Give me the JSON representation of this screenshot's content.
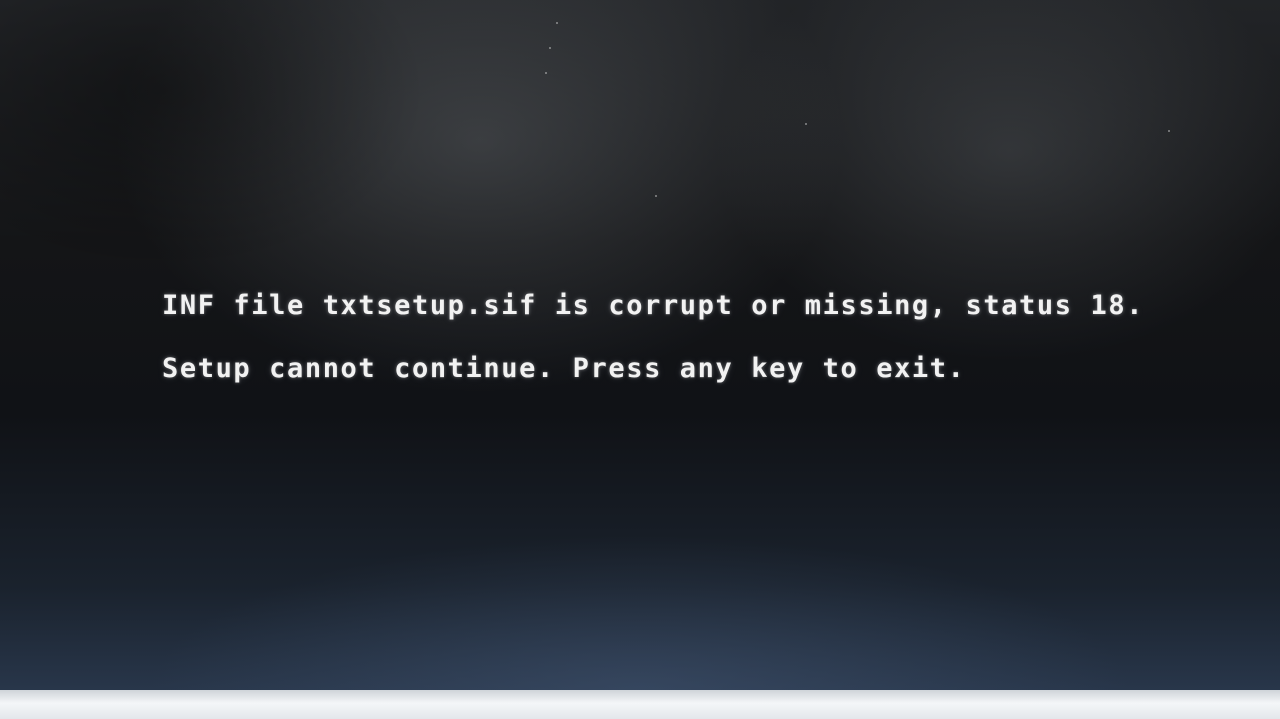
{
  "screen": {
    "lines": [
      "INF file txtsetup.sif is corrupt or missing, status 18.",
      "Setup cannot continue. Press any key to exit."
    ],
    "text_color": "#f2f2f2",
    "background_color": "#141517"
  }
}
